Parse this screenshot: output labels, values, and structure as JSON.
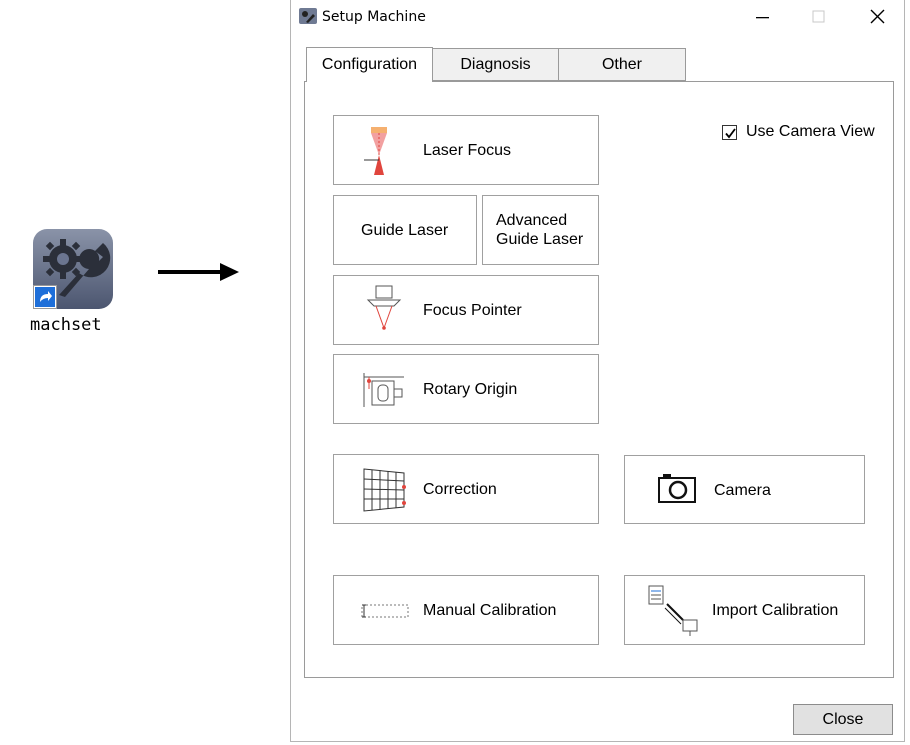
{
  "desktop": {
    "shortcut_label": "machset",
    "shortcut_icon": "gear-wrench-icon"
  },
  "window": {
    "title": "Setup Machine",
    "controls": {
      "minimize": "—",
      "maximize": "☐",
      "close": "✕"
    }
  },
  "tabs": [
    {
      "label": "Configuration",
      "active": true
    },
    {
      "label": "Diagnosis",
      "active": false
    },
    {
      "label": "Other",
      "active": false
    }
  ],
  "config": {
    "use_camera_view": {
      "label": "Use Camera View",
      "checked": true
    },
    "buttons": {
      "laser_focus": "Laser Focus",
      "guide_laser": "Guide Laser",
      "advanced_guide_laser_line1": "Advanced",
      "advanced_guide_laser_line2": "Guide Laser",
      "focus_pointer": "Focus Pointer",
      "rotary_origin": "Rotary Origin",
      "correction": "Correction",
      "camera": "Camera",
      "manual_calibration": "Manual Calibration",
      "import_calibration": "Import Calibration"
    }
  },
  "footer": {
    "close_label": "Close"
  },
  "colors": {
    "laser_red": "#e0453d",
    "laser_pink": "#f2a0a0",
    "laser_orange": "#f5b070"
  }
}
